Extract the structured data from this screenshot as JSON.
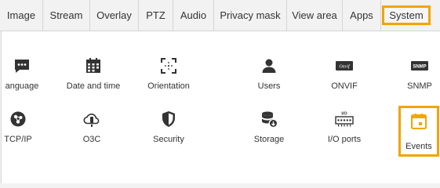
{
  "tabs": [
    {
      "label": "Image"
    },
    {
      "label": "Stream"
    },
    {
      "label": "Overlay"
    },
    {
      "label": "PTZ"
    },
    {
      "label": "Audio"
    },
    {
      "label": "Privacy mask"
    },
    {
      "label": "View area"
    },
    {
      "label": "Apps"
    },
    {
      "label": "System"
    }
  ],
  "active_tab": "System",
  "colors": {
    "accent": "#f0a500",
    "icon": "#333333",
    "events_icon": "#f0a500"
  },
  "tiles": [
    {
      "label": "anguage",
      "icon": "language-icon"
    },
    {
      "label": "Date and time",
      "icon": "calendar-icon"
    },
    {
      "label": "Orientation",
      "icon": "orientation-icon"
    },
    {
      "label": "Users",
      "icon": "user-icon"
    },
    {
      "label": "ONVIF",
      "icon": "onvif-icon",
      "badge": "Onvif"
    },
    {
      "label": "SNMP",
      "icon": "snmp-icon",
      "badge": "SNMP"
    },
    {
      "label": "TCP/IP",
      "icon": "network-icon"
    },
    {
      "label": "O3C",
      "icon": "cloud-icon"
    },
    {
      "label": "Security",
      "icon": "shield-icon"
    },
    {
      "label": "Storage",
      "icon": "storage-icon"
    },
    {
      "label": "I/O ports",
      "icon": "io-ports-icon",
      "badge": "I/O"
    },
    {
      "label": "Events",
      "icon": "events-icon"
    }
  ]
}
